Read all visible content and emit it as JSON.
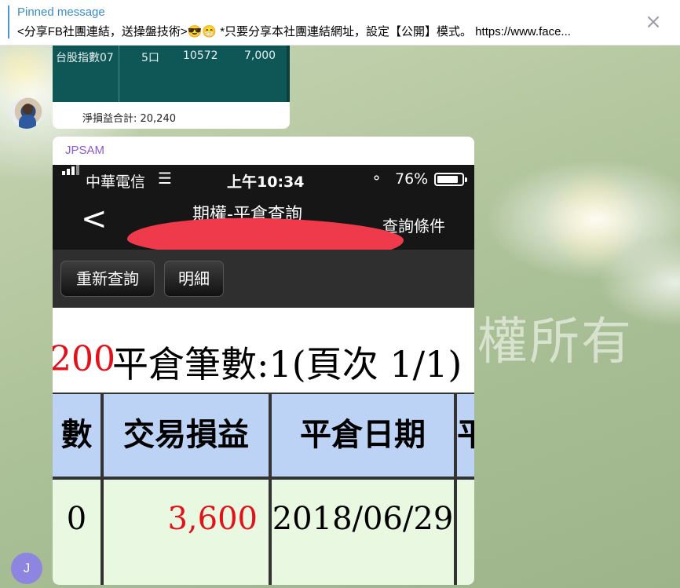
{
  "pinned": {
    "title": "Pinned message",
    "text": "<分享FB社團連結，送操盤技術>😎😁 *只要分享本社團連結網址，設定【公開】模式。 https://www.face...",
    "close_icon": "×"
  },
  "message1": {
    "row": {
      "name": "台股指數07",
      "qty": "5口",
      "price": "10572",
      "pnl": "7,000"
    },
    "caption": "淨損益合計: 20,240"
  },
  "message2": {
    "sender": "JPSAM",
    "status": {
      "carrier": "中華電信",
      "time": "上午10:34",
      "battery": "76%"
    },
    "nav": {
      "back": "<",
      "title": "期權-平倉查詢",
      "query": "查詢條件"
    },
    "buttons": {
      "requery": "重新查詢",
      "detail": "明細"
    },
    "summary": {
      "amount": "200",
      "title": "平倉筆數:1(頁次 1/1)"
    },
    "table": {
      "headers": [
        "數",
        "交易損益",
        "平倉日期",
        "平"
      ],
      "row": [
        "0",
        "3,600",
        "2018/06/29",
        ""
      ]
    }
  },
  "avatar_letter": "J",
  "watermark": "權所有",
  "colors": {
    "accent": "#4a95d6",
    "sender": "#8a5bd0",
    "loss_red": "#e2111a"
  }
}
